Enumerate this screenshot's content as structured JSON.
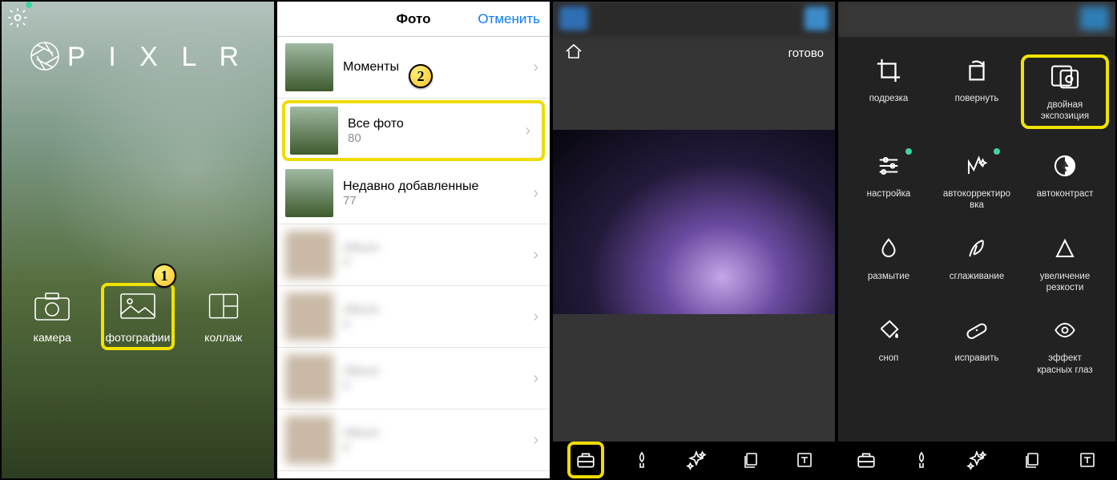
{
  "screen1": {
    "logo_text": "P I X L R",
    "gear_icon": "settings-gear",
    "buttons": {
      "camera": "камера",
      "photos": "фотографии",
      "collage": "коллаж"
    },
    "annotation_badge": "1"
  },
  "screen2": {
    "nav_title": "Фото",
    "cancel_label": "Отменить",
    "annotation_badge": "2",
    "albums": [
      {
        "title": "Моменты",
        "count": ""
      },
      {
        "title": "Все фото",
        "count": "80",
        "selected": true
      },
      {
        "title": "Недавно добавленные",
        "count": "77"
      },
      {
        "title": "",
        "count": "",
        "blurred": true
      },
      {
        "title": "",
        "count": "",
        "blurred": true
      },
      {
        "title": "",
        "count": "",
        "blurred": true
      },
      {
        "title": "",
        "count": "",
        "blurred": true
      }
    ]
  },
  "screen3": {
    "home_icon": "home",
    "done_label": "готово",
    "bottom_tools": [
      "toolbox",
      "brush",
      "sparkle",
      "layers",
      "text"
    ],
    "selected_bottom_tool": "toolbox"
  },
  "screen4": {
    "tools": [
      {
        "icon": "crop",
        "label": "подрезка"
      },
      {
        "icon": "rotate",
        "label": "повернуть"
      },
      {
        "icon": "double-exposure",
        "label": "двойная\nэкспозиция",
        "selected": true
      },
      {
        "icon": "sliders",
        "label": "настройка",
        "green_dot": true
      },
      {
        "icon": "autofix",
        "label": "автокорректиро\nвка",
        "green_dot": true
      },
      {
        "icon": "autocontrast",
        "label": "автоконтраст"
      },
      {
        "icon": "drop",
        "label": "размытие"
      },
      {
        "icon": "feather",
        "label": "сглаживание"
      },
      {
        "icon": "sharpen",
        "label": "увеличение\nрезкости"
      },
      {
        "icon": "bucket",
        "label": "сноп"
      },
      {
        "icon": "bandaid",
        "label": "исправить"
      },
      {
        "icon": "eye",
        "label": "эффект\nкрасных глаз"
      }
    ],
    "bottom_tools": [
      "toolbox",
      "brush",
      "sparkle",
      "layers",
      "text"
    ]
  }
}
